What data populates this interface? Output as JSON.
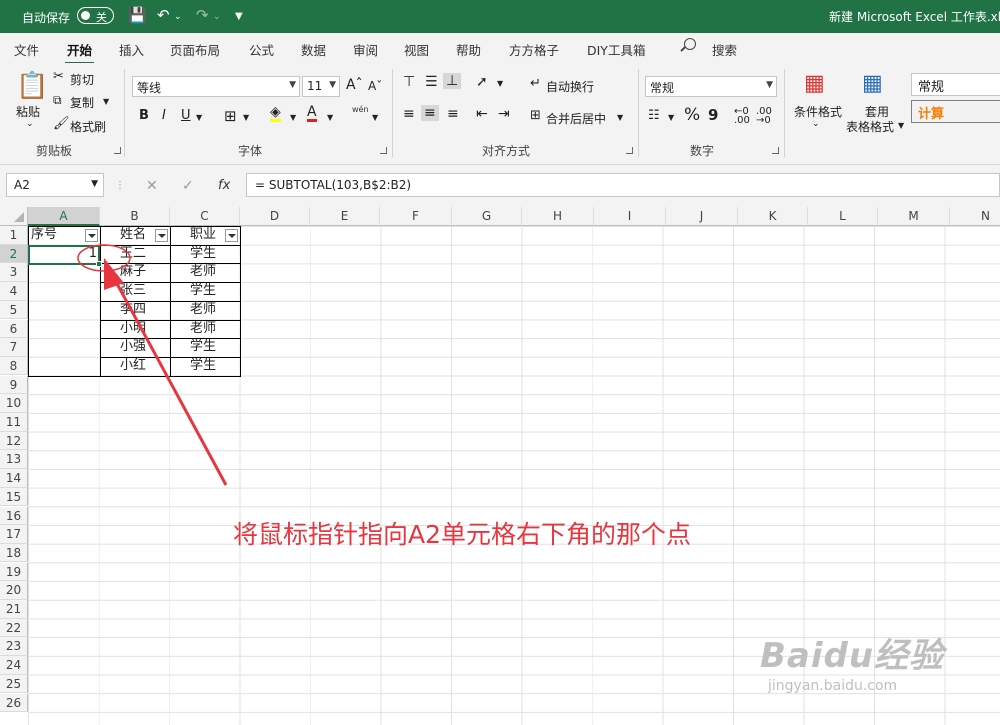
{
  "titlebar": {
    "autosave_label": "自动保存",
    "autosave_state": "关",
    "doc_title": "新建 Microsoft Excel 工作表.xlsx"
  },
  "menu": {
    "tabs": [
      "文件",
      "开始",
      "插入",
      "页面布局",
      "公式",
      "数据",
      "审阅",
      "视图",
      "帮助",
      "方方格子",
      "DIY工具箱"
    ],
    "active": "开始",
    "search_label": "搜索"
  },
  "ribbon": {
    "clipboard": {
      "paste": "粘贴",
      "cut": "剪切",
      "copy": "复制",
      "format_painter": "格式刷",
      "group": "剪贴板"
    },
    "font": {
      "name": "等线",
      "size": "11",
      "bold": "B",
      "italic": "I",
      "underline": "U",
      "group": "字体",
      "phonetic": "wén"
    },
    "align": {
      "wrap": "自动换行",
      "merge": "合并后居中",
      "group": "对齐方式"
    },
    "number": {
      "format": "常规",
      "percent": "%",
      "comma": "9",
      "group": "数字"
    },
    "styles": {
      "conditional": "条件格式",
      "table_fmt_1": "套用",
      "table_fmt_2": "表格格式",
      "normal": "常规",
      "calc": "计算"
    }
  },
  "formula_bar": {
    "name_box": "A2",
    "formula": "= SUBTOTAL(103,B$2:B2)",
    "fx": "fx"
  },
  "sheet": {
    "columns": [
      "A",
      "B",
      "C",
      "D",
      "E",
      "F",
      "G",
      "H",
      "I",
      "J",
      "K",
      "L",
      "M",
      "N"
    ],
    "rows": [
      "1",
      "2",
      "3",
      "4",
      "5",
      "6",
      "7",
      "8",
      "9",
      "10",
      "11",
      "12",
      "13",
      "14",
      "15",
      "16",
      "17",
      "18",
      "19",
      "20",
      "21",
      "22",
      "23",
      "24",
      "25",
      "26"
    ],
    "headers": [
      "序号",
      "姓名",
      "职业"
    ],
    "data": [
      [
        "1",
        "王二",
        "学生"
      ],
      [
        "",
        "麻子",
        "老师"
      ],
      [
        "",
        "张三",
        "学生"
      ],
      [
        "",
        "李四",
        "老师"
      ],
      [
        "",
        "小明",
        "老师"
      ],
      [
        "",
        "小强",
        "学生"
      ],
      [
        "",
        "小红",
        "学生"
      ]
    ],
    "selected_cell": "A2"
  },
  "annotation": {
    "text": "将鼠标指针指向A2单元格右下角的那个点",
    "color": "#e8363f"
  },
  "watermark": {
    "line1": "Baidu经验",
    "line2": "jingyan.baidu.com"
  },
  "colors": {
    "excel_green": "#217346"
  }
}
